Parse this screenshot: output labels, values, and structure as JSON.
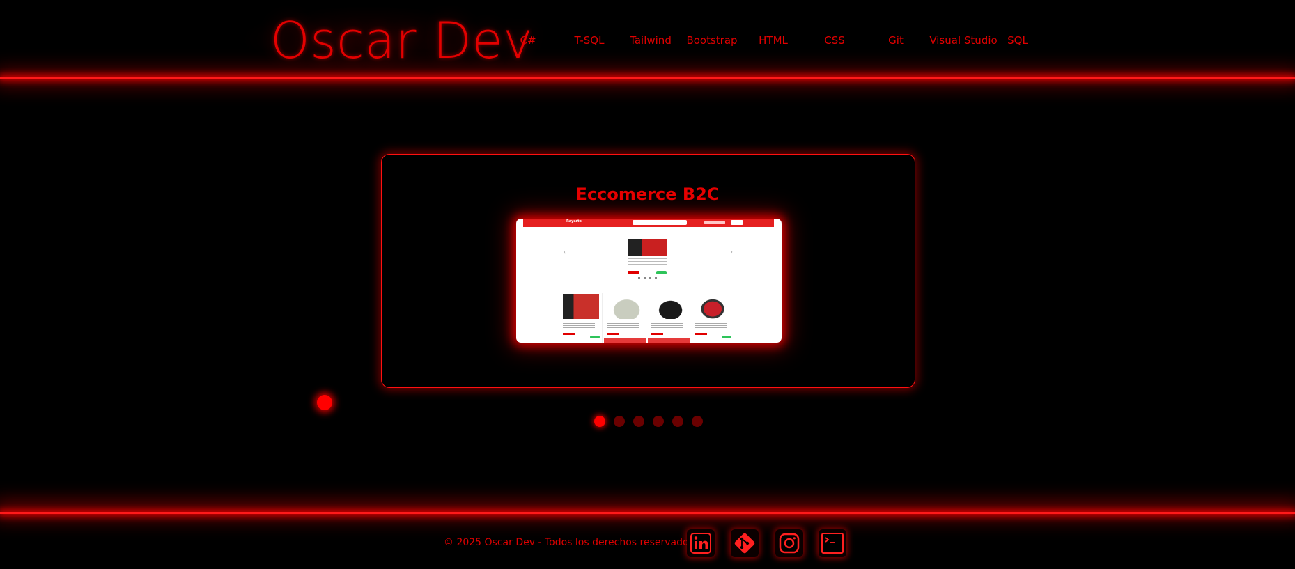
{
  "header": {
    "logo": "Oscar Dev",
    "nav": [
      {
        "label": "C#"
      },
      {
        "label": "T-SQL"
      },
      {
        "label": "Tailwind"
      },
      {
        "label": "Bootstrap"
      },
      {
        "label": "HTML"
      },
      {
        "label": "CSS"
      },
      {
        "label": "Git"
      },
      {
        "label": "Visual Studio"
      },
      {
        "label": "SQL"
      }
    ]
  },
  "carousel": {
    "title": "Eccomerce B2C",
    "slide_count": 6,
    "active_slide": 1,
    "preview_brand": "Rayarte"
  },
  "footer": {
    "copyright": "© 2025 Oscar Dev - Todos los derechos reservados.",
    "social": [
      {
        "icon": "linkedin-icon"
      },
      {
        "icon": "git-icon"
      },
      {
        "icon": "instagram-icon"
      },
      {
        "icon": "terminal-icon"
      }
    ]
  },
  "colors": {
    "background": "#000000",
    "accent": "#ff0000",
    "inactive_dot": "#6a0000"
  }
}
